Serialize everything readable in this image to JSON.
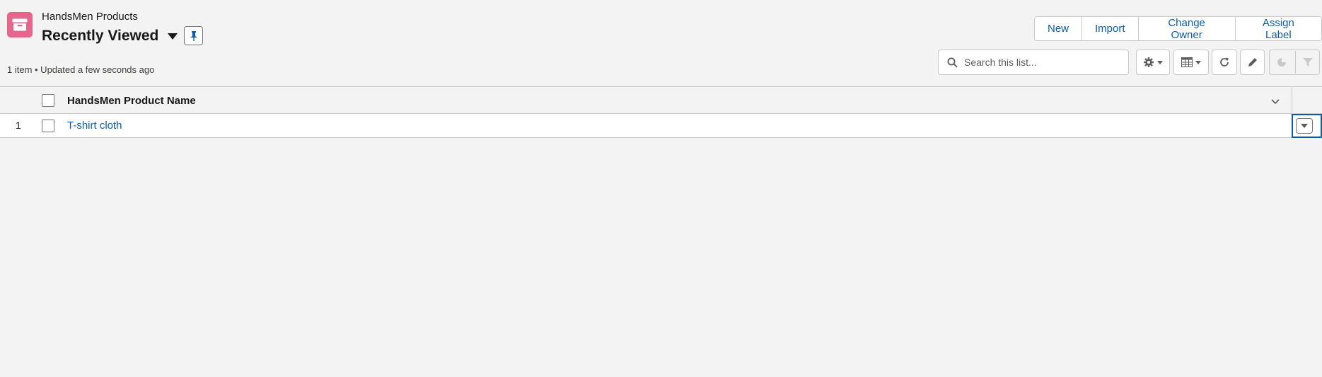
{
  "object": {
    "label": "HandsMen Products",
    "icon": "archive-box-icon",
    "icon_color": "#e3678c"
  },
  "list_view": {
    "title": "Recently Viewed",
    "status": "1 item • Updated a few seconds ago"
  },
  "actions": {
    "new": "New",
    "import": "Import",
    "change_owner": "Change Owner",
    "assign_label": "Assign Label"
  },
  "search": {
    "placeholder": "Search this list...",
    "value": ""
  },
  "toolbar_icons": {
    "settings": "gear-icon",
    "display_as": "table-icon",
    "refresh": "refresh-icon",
    "inline_edit": "pencil-icon",
    "charts": "pie-chart-icon",
    "filters": "filter-icon"
  },
  "table": {
    "columns": [
      {
        "label": "HandsMen Product Name"
      }
    ],
    "rows": [
      {
        "number": "1",
        "name": "T-shirt cloth"
      }
    ]
  },
  "colors": {
    "accent": "#0b5cab",
    "background": "#f3f3f3",
    "border": "#c9c9c9"
  }
}
